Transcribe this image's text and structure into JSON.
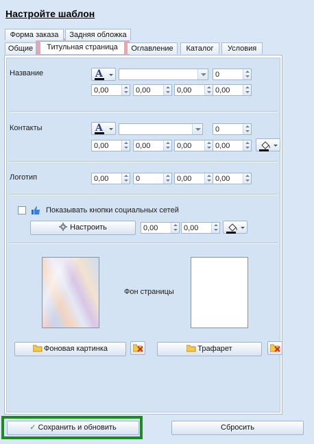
{
  "title": "Настройте шаблон",
  "tabs_row1": [
    {
      "label": "Форма заказа"
    },
    {
      "label": "Задняя обложка"
    }
  ],
  "tabs_row2": [
    {
      "label": "Общие"
    },
    {
      "label": "Титульная страница",
      "active": true
    },
    {
      "label": "Оглавление"
    },
    {
      "label": "Каталог"
    },
    {
      "label": "Условия"
    }
  ],
  "sections": {
    "name": {
      "label": "Название",
      "font_combo": "",
      "font_size": "0",
      "offsets": [
        "0,00",
        "0,00",
        "0,00",
        "0,00"
      ]
    },
    "contacts": {
      "label": "Контакты",
      "font_combo": "",
      "font_size": "0",
      "offsets": [
        "0,00",
        "0,00",
        "0,00",
        "0,00"
      ]
    },
    "logo": {
      "label": "Логотип",
      "offsets": [
        "0,00",
        "0",
        "0,00",
        "0,00"
      ]
    },
    "social": {
      "checkbox_label": "Показывать кнопки социальных сетей",
      "checked": false,
      "configure_label": "Настроить",
      "offsets": [
        "0,00",
        "0,00"
      ]
    },
    "background": {
      "page_bg_label": "Фон страницы",
      "bg_image_label": "Фоновая картинка",
      "stencil_label": "Трафарет"
    }
  },
  "footer": {
    "save_label": "Сохранить и обновить",
    "reset_label": "Сбросить"
  },
  "colors": {
    "panel_bg": "#d4e3f4",
    "active_tab_highlight": "#f1a3ac",
    "save_frame": "#1c8a1c",
    "font_glyph": "#283d8c"
  }
}
